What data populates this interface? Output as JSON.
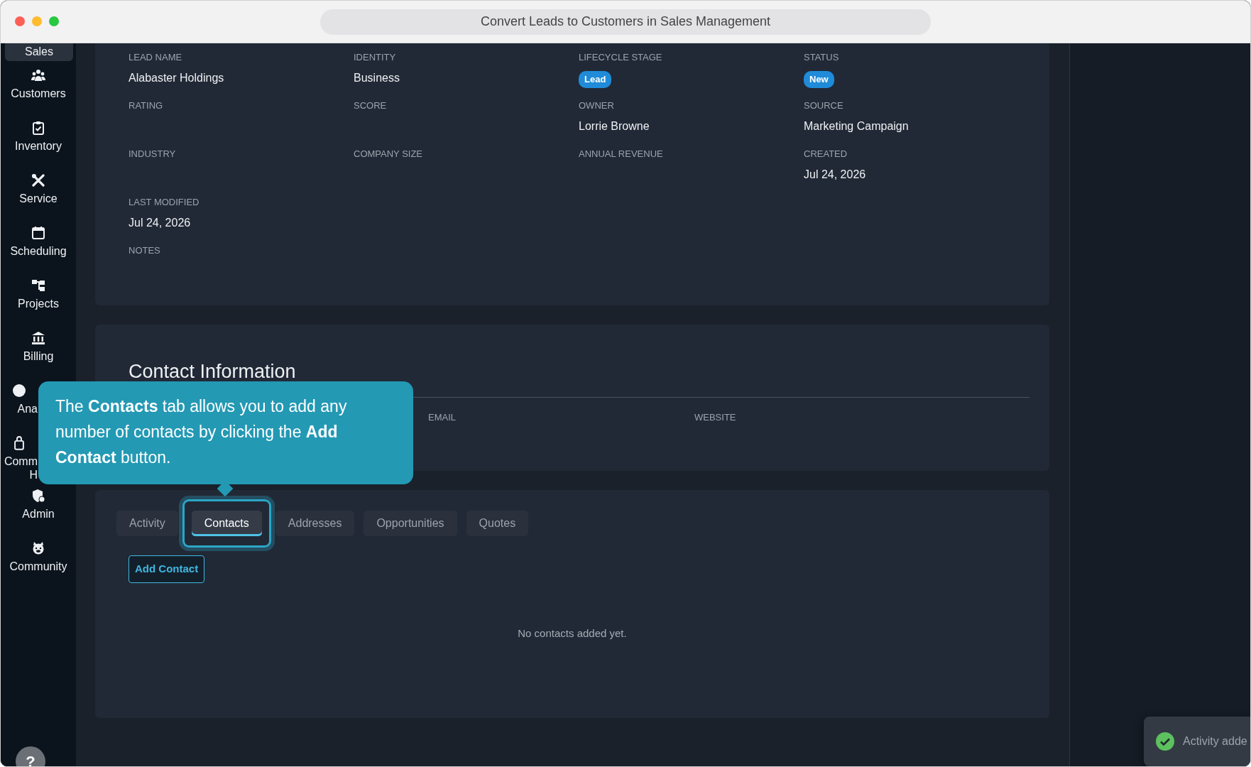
{
  "window": {
    "title": "Convert Leads to Customers in Sales Management"
  },
  "sidebar": {
    "items": [
      {
        "label": "Sales",
        "selected": true,
        "kind": "full"
      },
      {
        "label": "Customers",
        "selected": false,
        "kind": "full"
      },
      {
        "label": "Inventory",
        "selected": false,
        "kind": "full"
      },
      {
        "label": "Service",
        "selected": false,
        "kind": "full"
      },
      {
        "label": "Scheduling",
        "selected": false,
        "kind": "full"
      },
      {
        "label": "Projects",
        "selected": false,
        "kind": "full"
      },
      {
        "label": "Billing",
        "selected": false,
        "kind": "full"
      },
      {
        "label": "Ana",
        "selected": false,
        "kind": "partial"
      },
      {
        "label": "Comm\nH",
        "selected": false,
        "kind": "partial"
      },
      {
        "label": "Admin",
        "selected": false,
        "kind": "full"
      },
      {
        "label": "Community",
        "selected": false,
        "kind": "full"
      }
    ],
    "help_button": {
      "label": "?"
    }
  },
  "lead_details": {
    "fields": [
      {
        "label": "LEAD NAME",
        "value": "Alabaster Holdings",
        "kind": "text"
      },
      {
        "label": "IDENTITY",
        "value": "Business",
        "kind": "text"
      },
      {
        "label": "LIFECYCLE STAGE",
        "value": "Lead",
        "kind": "badge"
      },
      {
        "label": "STATUS",
        "value": "New",
        "kind": "badge"
      },
      {
        "label": "RATING",
        "kind": "text"
      },
      {
        "label": "SCORE",
        "kind": "text"
      },
      {
        "label": "OWNER",
        "value": "Lorrie Browne",
        "kind": "text"
      },
      {
        "label": "SOURCE",
        "value": "Marketing Campaign",
        "kind": "text"
      },
      {
        "label": "INDUSTRY",
        "kind": "text"
      },
      {
        "label": "COMPANY SIZE",
        "kind": "text"
      },
      {
        "label": "ANNUAL REVENUE",
        "kind": "text"
      },
      {
        "label": "CREATED",
        "value": "Jul 24, 2026",
        "kind": "text"
      },
      {
        "label": "LAST MODIFIED",
        "value": "Jul 24, 2026",
        "kind": "text"
      },
      {
        "label": "NOTES",
        "kind": "wide"
      }
    ]
  },
  "contact_information": {
    "title": "Contact Information",
    "columns": [
      "EMAIL",
      "WEBSITE"
    ]
  },
  "related": {
    "tabs": [
      {
        "label": "Activity",
        "selected": false
      },
      {
        "label": "Contacts",
        "selected": true
      },
      {
        "label": "Addresses",
        "selected": false
      },
      {
        "label": "Opportunities",
        "selected": false
      },
      {
        "label": "Quotes",
        "selected": false
      }
    ],
    "action_button": "Add Contact",
    "empty_message": "No contacts added yet."
  },
  "tooltip": {
    "text": "The **Contacts** tab allows you to add any number of contacts by clicking the **Add Contact** button."
  },
  "toast": {
    "message": "Activity adde",
    "kind": "success"
  }
}
